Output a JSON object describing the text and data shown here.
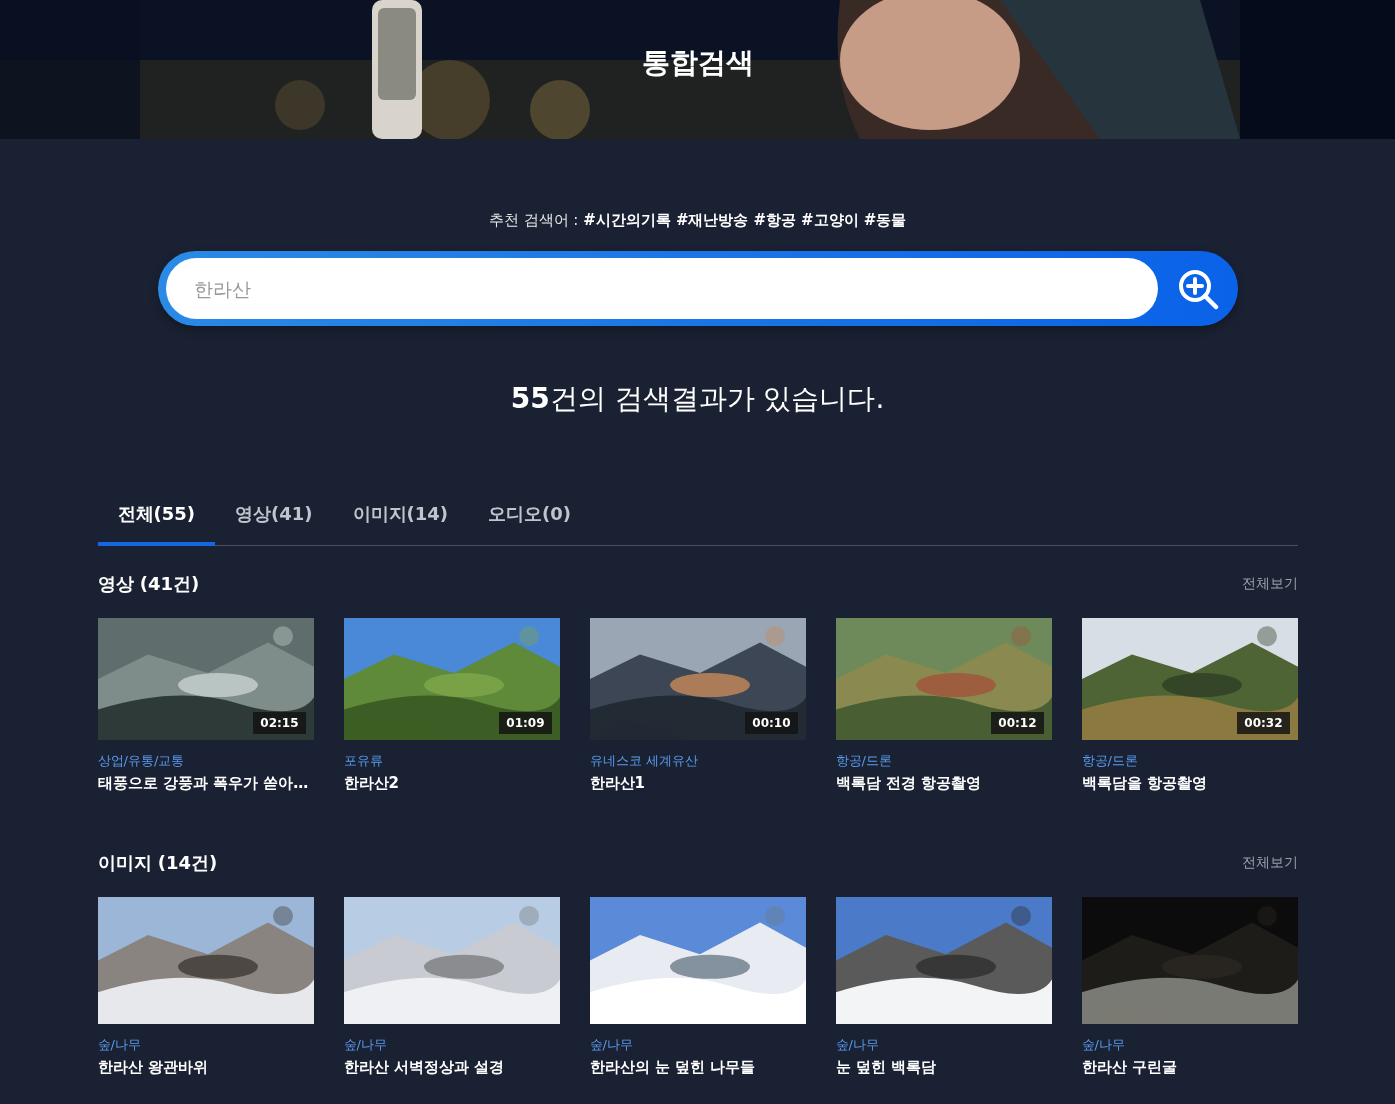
{
  "header": {
    "title": "통합검색"
  },
  "recommended": {
    "label": "추천 검색어 :",
    "tags": [
      "#시간의기록",
      "#재난방송",
      "#항공",
      "#고양이",
      "#동물"
    ]
  },
  "search": {
    "placeholder": "한라산"
  },
  "result_summary": "**55**건의 검색결과가 있습니다.",
  "tabs": [
    {
      "label": "전체(55)",
      "selected": true
    },
    {
      "label": "영상(41)",
      "selected": false
    },
    {
      "label": "이미지(14)",
      "selected": false
    },
    {
      "label": "오디오(0)",
      "selected": false
    }
  ],
  "sections": [
    {
      "title": "영상 (41건)",
      "more": "전체보기",
      "kind": "video",
      "items": [
        {
          "category": "상업/유통/교통",
          "title": "태풍으로 강풍과 폭우가 쏟아…",
          "duration": "02:15"
        },
        {
          "category": "포유류",
          "title": "한라산2",
          "duration": "01:09"
        },
        {
          "category": "유네스코 세계유산",
          "title": "한라산1",
          "duration": "00:10"
        },
        {
          "category": "항공/드론",
          "title": "백록담 전경 항공촬영",
          "duration": "00:12"
        },
        {
          "category": "항공/드론",
          "title": "백록담을 항공촬영",
          "duration": "00:32"
        }
      ]
    },
    {
      "title": "이미지 (14건)",
      "more": "전체보기",
      "items": [
        {
          "category": "숲/나무",
          "title": "한라산 왕관바위"
        },
        {
          "category": "숲/나무",
          "title": "한라산 서벽정상과 설경"
        },
        {
          "category": "숲/나무",
          "title": "한라산의 눈 덮힌 나무들"
        },
        {
          "category": "숲/나무",
          "title": "눈 덮힌 백록담"
        },
        {
          "category": "숲/나무",
          "title": "한라산 구린굴"
        }
      ]
    }
  ]
}
